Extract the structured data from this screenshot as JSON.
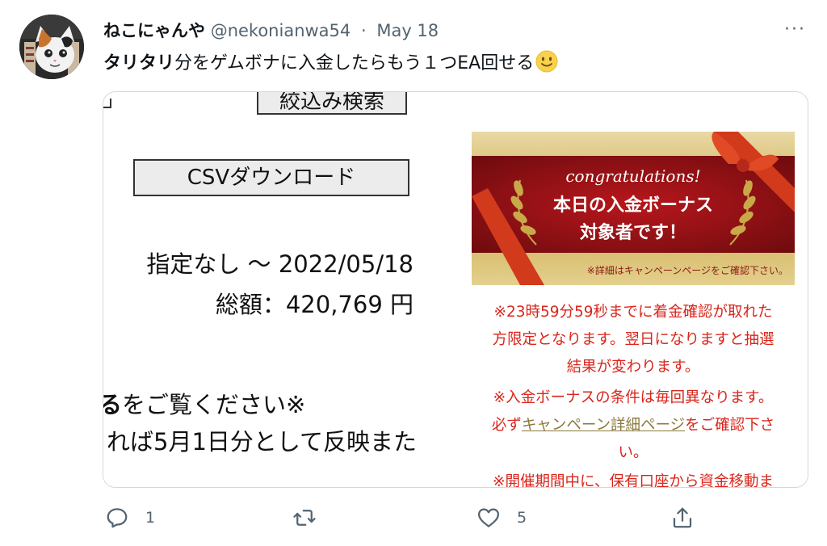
{
  "tweet": {
    "display_name": "ねこにゃんや",
    "handle": "@nekonianwa54",
    "separator": "·",
    "date": "May 18",
    "more_label": "···",
    "text_emph": "タリタリ",
    "text_rest": "分をゲムボナに入金したらもう１つEA回せる",
    "emoji": "slightly-smiling-face"
  },
  "left_image": {
    "filter_button": "絞込み検索",
    "csv_button": "CSVダウンロード",
    "period": "指定なし 〜 2022/05/18",
    "total": "総額：420,769 円",
    "note1": "をご覧ください※",
    "note2": "れば5月1日分として反映また"
  },
  "right_image": {
    "banner": {
      "congrats": "congratulations!",
      "line1": "本日の入金ボーナス",
      "line2": "対象者です！",
      "footnote": "※詳細はキャンペーンページをご確認下さい。"
    },
    "lines": [
      "※23時59分59秒までに着金確認が取れた",
      "方限定となります。翌日になりますと抽選",
      "結果が変わります。",
      "※入金ボーナスの条件は毎回異なります。"
    ],
    "line5_pre": "必ず",
    "line5_link": "キャンペーン詳細ページ",
    "line5_post": "をご確認下さ",
    "line6": "い。",
    "line7": "※開催期間中に、保有口座から資金移動ま"
  },
  "actions": {
    "reply_count": "1",
    "retweet_count": "",
    "like_count": "5"
  },
  "colors": {
    "text_primary": "#0f1419",
    "text_secondary": "#536471",
    "border": "#cfd9de",
    "notice_red": "#d9261c",
    "banner_red": "#9b1216",
    "banner_gold": "#c9a84a"
  }
}
